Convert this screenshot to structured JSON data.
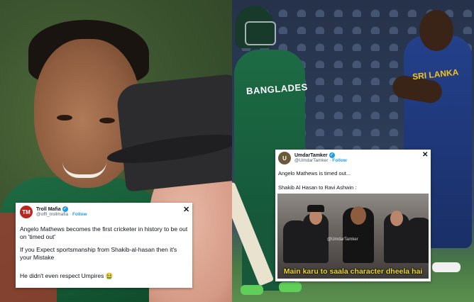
{
  "left_tweet": {
    "avatar_text": "TM",
    "name": "Troll Mafia",
    "handle": "@offl_trollmafia",
    "follow_label": "Follow",
    "line1": "Angelo Mathews becomes the first cricketer in history to be out on 'timed out'",
    "line2": "If you Expect sportsmanship from Shakib-al-hasan then it's your Mistake",
    "line3": "He didn't even respect Umpires 🤮"
  },
  "right_tweet": {
    "avatar_text": "U",
    "name": "UmdarTamker",
    "handle": "@UmdarTamker",
    "follow_label": "Follow",
    "line1": "Angelo Mathews is timed out...",
    "line2": "Shakib Al Hasan to Ravi Ashwin :",
    "meme_watermark": "@UmdarTamker",
    "meme_caption": "Main karu to saala character dheela hai"
  },
  "photo_text": {
    "bangladesh_jersey": "BANGLADES",
    "srilanka_jersey": "SRI LANKA"
  },
  "icons": {
    "close": "✕",
    "verified": "✓"
  },
  "colors": {
    "link": "#1d9bf0",
    "caption_yellow": "#f4dc1b"
  }
}
